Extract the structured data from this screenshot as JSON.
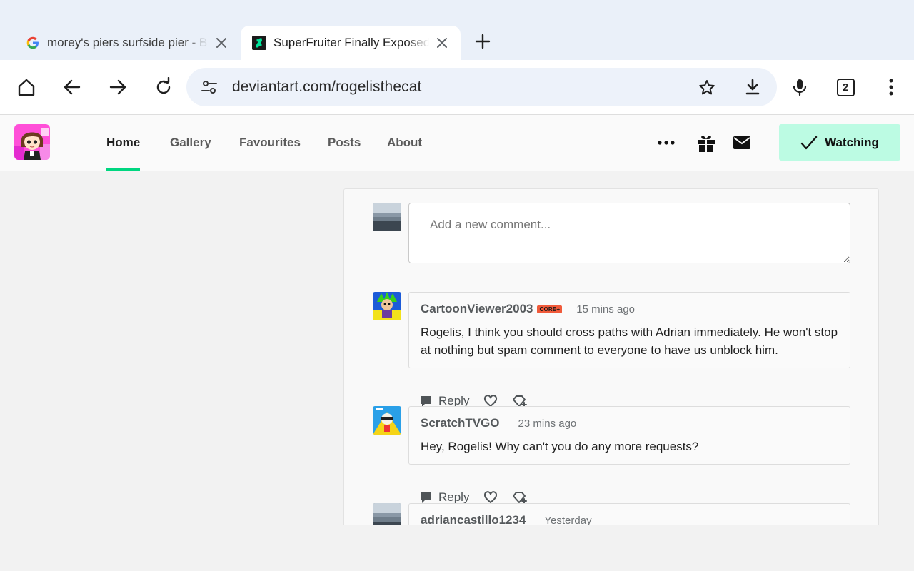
{
  "browser": {
    "tabs": [
      {
        "title": "morey's piers surfside pier - B",
        "active": false
      },
      {
        "title": "SuperFruiter Finally Exposed",
        "active": true
      }
    ],
    "url": "deviantart.com/rogelisthecat",
    "tab_count": "2"
  },
  "site_nav": {
    "items": [
      "Home",
      "Gallery",
      "Favourites",
      "Posts",
      "About"
    ],
    "active": "Home",
    "watch_label": "Watching"
  },
  "comment_box": {
    "placeholder": "Add a new comment..."
  },
  "comments": [
    {
      "username": "CartoonViewer2003",
      "badge": "CORE+",
      "time": "15 mins ago",
      "text": "Rogelis, I think you should cross paths with Adrian immediately. He won't stop at nothing but spam comment to everyone to have us unblock him.",
      "reply_label": "Reply"
    },
    {
      "username": "ScratchTVGO",
      "time": "23 mins ago",
      "text": "Hey, Rogelis! Why can't you do any more requests?",
      "reply_label": "Reply"
    },
    {
      "username": "adriancastillo1234",
      "time": "Yesterday"
    }
  ],
  "colors": {
    "accent": "#00d680",
    "watch_bg": "#bcfbe3",
    "core_badge": "#f05a3a"
  }
}
